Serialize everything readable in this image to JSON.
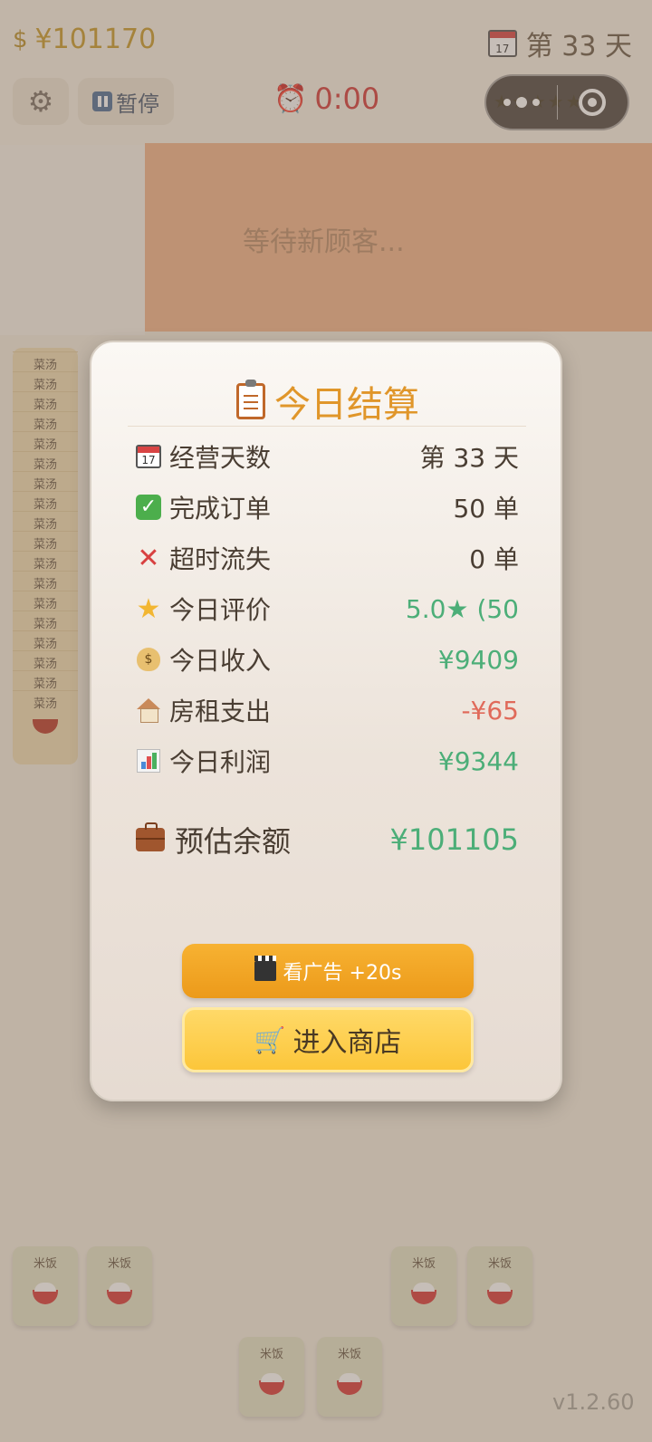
{
  "hud": {
    "money": "¥101170",
    "day": "第 33 天",
    "pause_label": "暂停",
    "timer": "0:00",
    "stars": "★★★★★"
  },
  "board": {
    "waiting_text": "等待新顾客...",
    "soup_label": "菜汤",
    "soup_count": 18,
    "rice_label": "米饭",
    "version": "v1.2.60"
  },
  "summary": {
    "title": "今日结算",
    "rows": [
      {
        "icon": "calendar-icon",
        "label": "经营天数",
        "value": "第 33 天",
        "tone": "normal"
      },
      {
        "icon": "check-icon",
        "label": "完成订单",
        "value": "50 单",
        "tone": "normal"
      },
      {
        "icon": "cross-icon",
        "label": "超时流失",
        "value": "0 单",
        "tone": "normal"
      },
      {
        "icon": "star-icon",
        "label": "今日评价",
        "value": "5.0★ (50",
        "tone": "green"
      },
      {
        "icon": "money-bag-icon",
        "label": "今日收入",
        "value": "¥9409",
        "tone": "green"
      },
      {
        "icon": "house-icon",
        "label": "房租支出",
        "value": "-¥65",
        "tone": "red"
      },
      {
        "icon": "chart-icon",
        "label": "今日利润",
        "value": "¥9344",
        "tone": "green"
      }
    ],
    "balance_label": "预估余额",
    "balance_value": "¥101105",
    "ad_button": "看广告 +20s",
    "shop_button": "进入商店"
  },
  "colors": {
    "title": "#e0962a",
    "positive": "#4cae78",
    "negative": "#e06a5a",
    "ad_button": "#f0a424",
    "shop_button": "#fdcf4e"
  }
}
